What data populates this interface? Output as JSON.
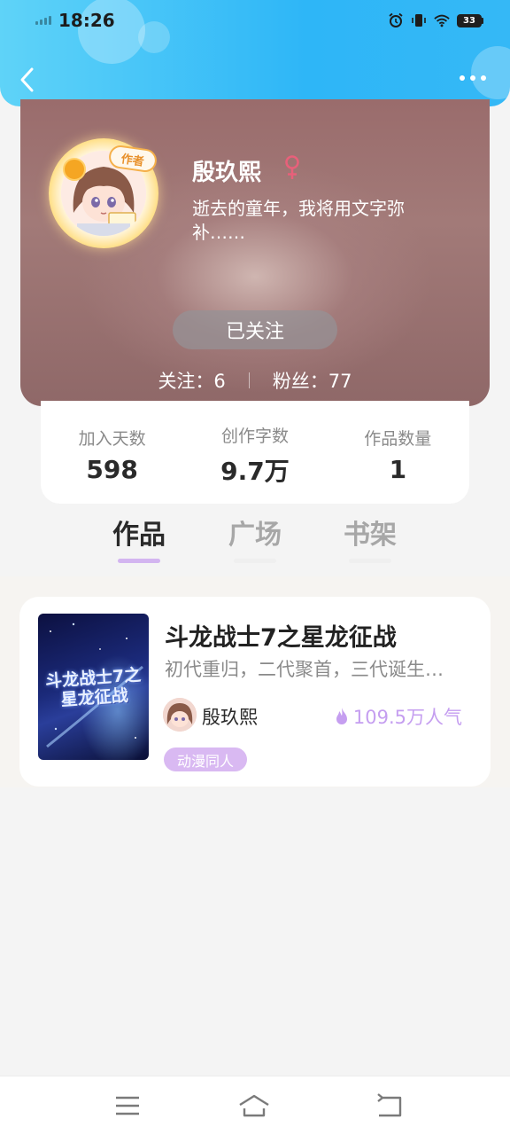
{
  "status_bar": {
    "time": "18:26",
    "battery": "33"
  },
  "profile": {
    "name": "殷玖熙",
    "author_badge": "作者",
    "bio": "逝去的童年，我将用文字弥补……",
    "follow_button": "已关注",
    "following_label": "关注：6",
    "fans_label": "粉丝：77"
  },
  "stats": [
    {
      "label": "加入天数",
      "value": "598"
    },
    {
      "label": "创作字数",
      "value": "9.7万"
    },
    {
      "label": "作品数量",
      "value": "1"
    }
  ],
  "tabs": [
    {
      "label": "作品",
      "active": true
    },
    {
      "label": "广场",
      "active": false
    },
    {
      "label": "书架",
      "active": false
    }
  ],
  "work": {
    "title": "斗龙战士7之星龙征战",
    "cover_text": "斗龙战士7之星龙征战",
    "description": "初代重归，二代聚首，三代诞生……",
    "author": "殷玖熙",
    "popularity": "109.5万人气",
    "tag": "动漫同人"
  },
  "colors": {
    "header": "#2eb6f7",
    "accent_purple": "#c59ef0",
    "tag_bg": "#d9b9f2",
    "gender": "#e8607a"
  }
}
